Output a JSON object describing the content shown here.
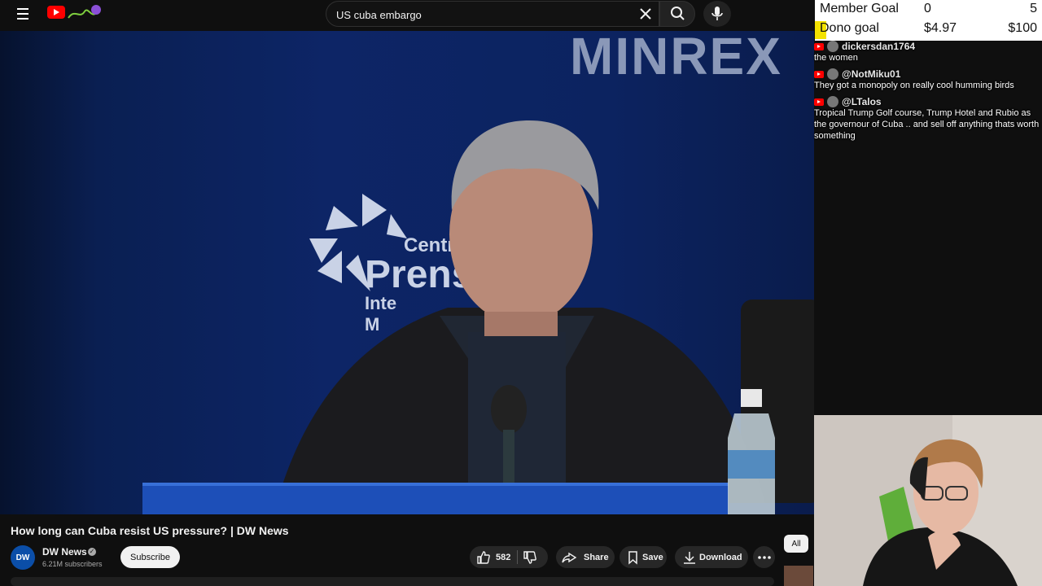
{
  "search": {
    "query": "US cuba embargo"
  },
  "video": {
    "title": "How long can Cuba resist US pressure? | DW News",
    "backdrop_text": "MINREX",
    "logo_lines": [
      "Centro",
      "Prensa",
      "Inte",
      "M"
    ]
  },
  "channel": {
    "name": "DW News",
    "avatar_text": "DW",
    "subscribers": "6.21M subscribers",
    "subscribe_label": "Subscribe"
  },
  "actions": {
    "likes": "582",
    "share": "Share",
    "save": "Save",
    "download": "Download"
  },
  "filters": {
    "all": "All"
  },
  "goals": {
    "member": {
      "label": "Member Goal",
      "current": "0",
      "target": "5"
    },
    "dono": {
      "label": "Dono goal",
      "current": "$4.97",
      "target": "$100",
      "progress": 0.0497
    }
  },
  "chat": [
    {
      "user": "dickersdan1764",
      "text": "the women"
    },
    {
      "user": "@NotMiku01",
      "text": "They got a monopoly on really cool humming birds"
    },
    {
      "user": "@LTalos",
      "text": "Tropical Trump Golf course, Trump Hotel and Rubio as the governour of Cuba .. and sell off anything thats worth something"
    }
  ],
  "colors": {
    "brand_red": "#ff0000",
    "goal_fill": "#f3e200",
    "video_bg": "#0d2566"
  }
}
